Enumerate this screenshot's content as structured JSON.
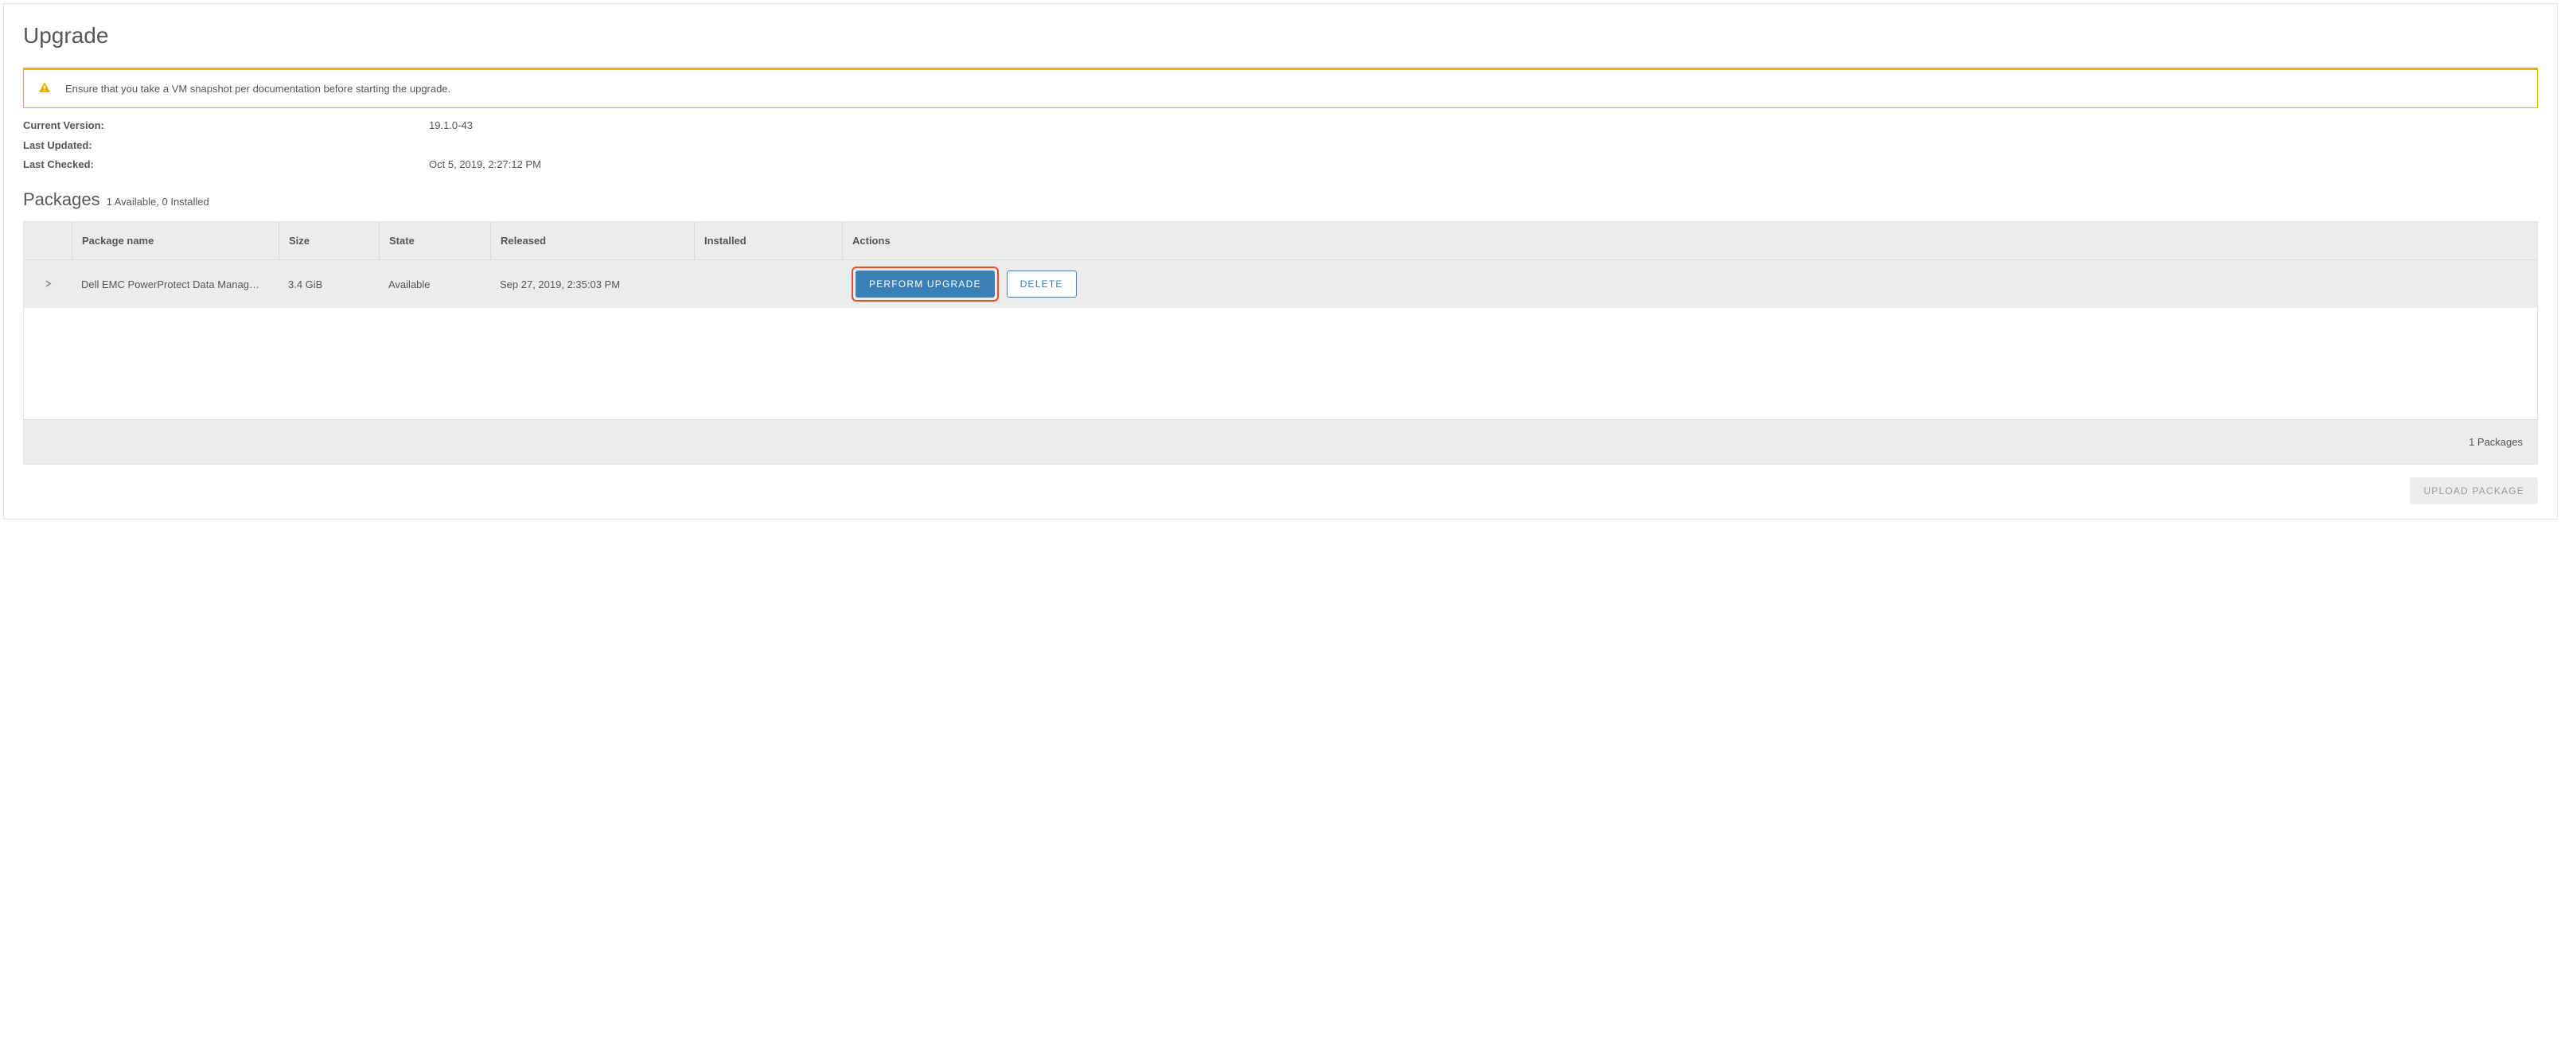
{
  "page": {
    "title": "Upgrade"
  },
  "alert": {
    "message": "Ensure that you take a VM snapshot per documentation before starting the upgrade."
  },
  "info": {
    "current_version_label": "Current Version:",
    "current_version_value": "19.1.0-43",
    "last_updated_label": "Last Updated:",
    "last_updated_value": "",
    "last_checked_label": "Last Checked:",
    "last_checked_value": "Oct 5, 2019, 2:27:12 PM"
  },
  "packages_section": {
    "title": "Packages",
    "subtitle": "1 Available, 0 Installed"
  },
  "table": {
    "headers": {
      "package_name": "Package name",
      "size": "Size",
      "state": "State",
      "released": "Released",
      "installed": "Installed",
      "actions": "Actions"
    },
    "rows": [
      {
        "name": "Dell EMC PowerProtect Data Manag…",
        "size": "3.4 GiB",
        "state": "Available",
        "released": "Sep 27, 2019, 2:35:03 PM",
        "installed": ""
      }
    ],
    "footer": "1 Packages"
  },
  "actions": {
    "perform_upgrade": "PERFORM UPGRADE",
    "delete": "DELETE",
    "upload_package": "UPLOAD PACKAGE"
  }
}
